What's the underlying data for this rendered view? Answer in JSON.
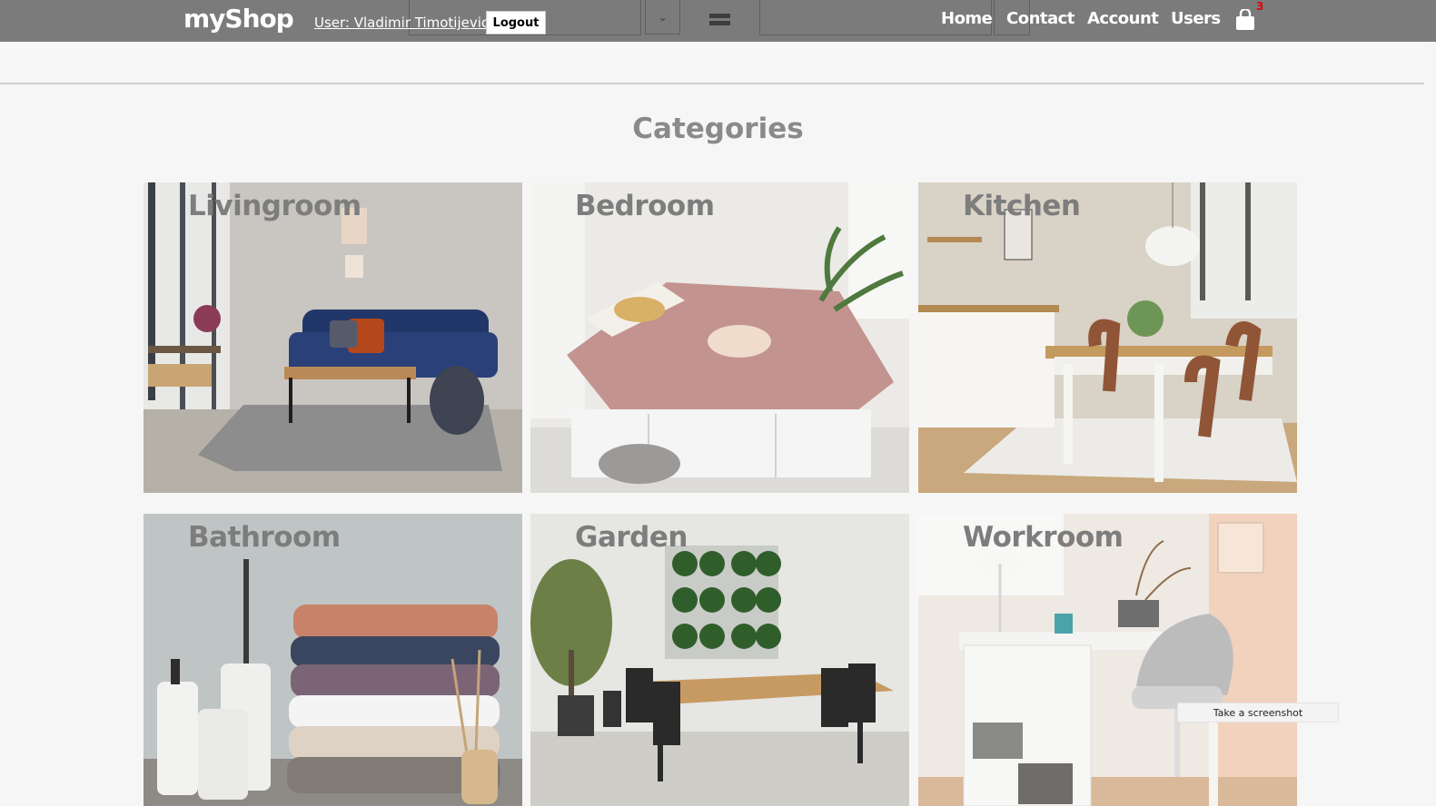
{
  "header": {
    "logo": "myShop",
    "user_link": "User: Vladimir Timotijevic",
    "logout_label": "Logout",
    "nav": {
      "home": "Home",
      "contact": "Contact",
      "account": "Account",
      "users": "Users"
    },
    "cart_icon": "shopping-bag-icon",
    "cart_count": "3",
    "select_icon": "chevron-down-icon",
    "menu_icon": "hamburger-icon",
    "colors": {
      "bar": "#7b7b7b",
      "text": "#ffffff",
      "badge": "#e00000"
    }
  },
  "main": {
    "title": "Categories",
    "categories": [
      {
        "label": "Livingroom"
      },
      {
        "label": "Bedroom"
      },
      {
        "label": "Kitchen"
      },
      {
        "label": "Bathroom"
      },
      {
        "label": "Garden"
      },
      {
        "label": "Workroom"
      }
    ]
  },
  "overlay": {
    "tooltip": "Take a screenshot"
  }
}
